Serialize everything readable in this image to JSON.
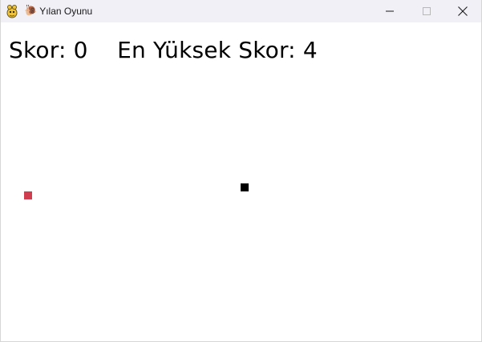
{
  "window": {
    "title": "Yılan Oyunu",
    "title_prefix_icon": "snail-icon",
    "app_icon": "pygame-snake-icon",
    "buttons": {
      "minimize": "minimize-icon",
      "maximize": "maximize-icon",
      "close": "close-icon"
    }
  },
  "game": {
    "score_label": "Skor: 0",
    "high_score_label": "En Yüksek Skor: 4",
    "colors": {
      "background": "#ffffff",
      "snake": "#000000",
      "food": "#d03d4f",
      "text": "#000000"
    }
  }
}
